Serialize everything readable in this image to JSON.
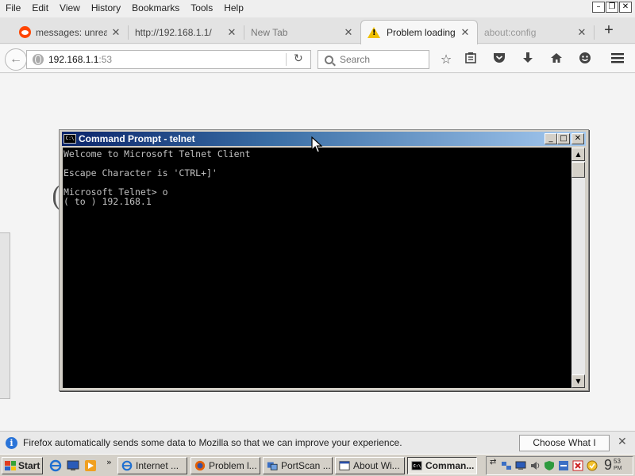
{
  "menubar": {
    "items": [
      "File",
      "Edit",
      "View",
      "History",
      "Bookmarks",
      "Tools",
      "Help"
    ]
  },
  "tabs": [
    {
      "label": "messages: unread",
      "icon": "reddit-icon"
    },
    {
      "label": "http://192.168.1.1/",
      "icon": ""
    },
    {
      "label": "New Tab",
      "icon": ""
    },
    {
      "label": "Problem loading ...",
      "icon": "warning-icon"
    },
    {
      "label": "about:config",
      "icon": ""
    }
  ],
  "navbar": {
    "url_host": "192.168.1.1",
    "url_port": ":53",
    "search_placeholder": "Search"
  },
  "cmd": {
    "title": "Command Prompt - telnet",
    "lines": [
      "Welcome to Microsoft Telnet Client",
      "",
      "Escape Character is 'CTRL+]'",
      "",
      "Microsoft Telnet> o",
      "( to ) 192.168.1"
    ]
  },
  "notification": {
    "text": "Firefox automatically sends some data to Mozilla so that we can improve your experience.",
    "button_label": "Choose What I Share"
  },
  "taskbar": {
    "start_label": "Start",
    "tasks": [
      {
        "label": "Internet ...",
        "icon": "ie-icon"
      },
      {
        "label": "Problem l...",
        "icon": "firefox-icon"
      },
      {
        "label": "PortScan ...",
        "icon": "portscan-icon"
      },
      {
        "label": "About Wi...",
        "icon": "window-icon"
      },
      {
        "label": "Comman...",
        "icon": "cmd-icon"
      }
    ],
    "clock": {
      "hour": "9",
      "minutes": "53",
      "ampm": "PM"
    }
  },
  "colors": {
    "titlebar_start": "#0a246a",
    "titlebar_end": "#a6caf0",
    "console_bg": "#000000",
    "console_text": "#c0c0c0",
    "info_blue": "#2a74d8"
  }
}
